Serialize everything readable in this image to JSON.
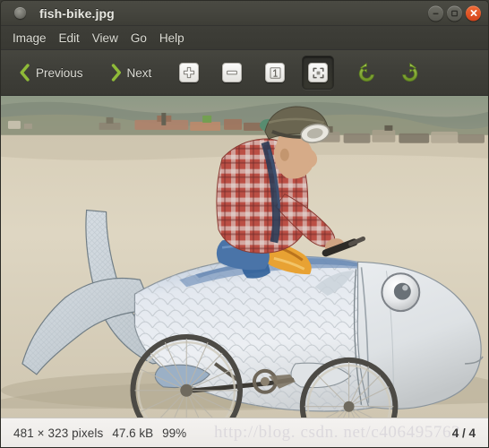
{
  "window": {
    "title": "fish-bike.jpg",
    "icon": "image-viewer-icon",
    "controls": {
      "minimize": "Minimize",
      "maximize": "Maximize",
      "close": "Close"
    }
  },
  "menubar": {
    "items": [
      {
        "label": "Image"
      },
      {
        "label": "Edit"
      },
      {
        "label": "View"
      },
      {
        "label": "Go"
      },
      {
        "label": "Help"
      }
    ]
  },
  "toolbar": {
    "previous_label": "Previous",
    "next_label": "Next",
    "buttons": [
      {
        "name": "zoom-in",
        "icon": "plus-icon"
      },
      {
        "name": "zoom-out",
        "icon": "minus-icon"
      },
      {
        "name": "normal-size",
        "icon": "one-to-one-icon"
      },
      {
        "name": "best-fit",
        "icon": "best-fit-icon",
        "active": true
      },
      {
        "name": "rotate-left",
        "icon": "rotate-counterclockwise-icon"
      },
      {
        "name": "rotate-right",
        "icon": "rotate-clockwise-icon"
      }
    ]
  },
  "image": {
    "alt": "Man riding a silver fish-shaped art bicycle on a desert playa",
    "filename": "fish-bike.jpg"
  },
  "statusbar": {
    "dimensions": "481 × 323 pixels",
    "filesize": "47.6 kB",
    "zoom": "99%",
    "position": "4 / 4"
  },
  "watermark": {
    "text": "http://blog. csdn. net/c406495762"
  },
  "colors": {
    "titlebar": "#45453e",
    "toolbar": "#3f3f39",
    "menu_text": "#dcdcd4",
    "accent_green": "#8cb935",
    "close_button": "#d3431a",
    "statusbar_bg": "#eceae7"
  }
}
